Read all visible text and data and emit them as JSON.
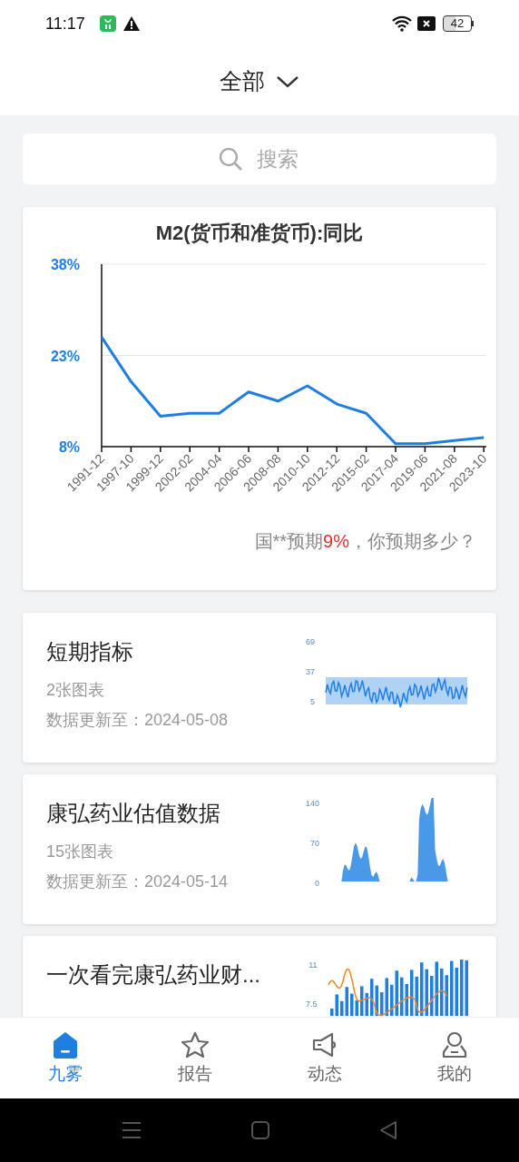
{
  "status_bar": {
    "time": "11:17",
    "battery": "42"
  },
  "header": {
    "title": "全部"
  },
  "search": {
    "placeholder": "搜索"
  },
  "main_chart": {
    "title": "M2(货币和准货币):同比",
    "footer": {
      "prefix": "国**预期",
      "highlight": "9%",
      "suffix": "，你预期多少？"
    },
    "chart_data": {
      "type": "line",
      "categories": [
        "1991-12",
        "1997-10",
        "1999-12",
        "2002-02",
        "2004-04",
        "2006-06",
        "2008-08",
        "2010-10",
        "2012-12",
        "2015-02",
        "2017-04",
        "2019-06",
        "2021-08",
        "2023-10"
      ],
      "series": [
        {
          "color": "#1e7fe0",
          "values": [
            26,
            18.7,
            13,
            13.5,
            13.5,
            17,
            15.5,
            18,
            15,
            13.5,
            8.5,
            8.5,
            9,
            9.5
          ]
        }
      ],
      "ylim": [
        8,
        38
      ],
      "yticks": [
        {
          "value": 38,
          "label": "38%"
        },
        {
          "value": 23,
          "label": "23%"
        },
        {
          "value": 8,
          "label": "8%"
        }
      ]
    }
  },
  "cards": [
    {
      "title": "短期指标",
      "count": "2张图表",
      "updated": "数据更新至：2024-05-08",
      "thumbnail": {
        "kind": "line",
        "y_ticks": [
          "69",
          "37",
          "5"
        ]
      }
    },
    {
      "title": "康弘药业估值数据",
      "count": "15张图表",
      "updated": "数据更新至：2024-05-14",
      "thumbnail": {
        "kind": "area",
        "y_ticks": [
          "140",
          "70",
          "0"
        ]
      }
    },
    {
      "title": "一次看完康弘药业财...",
      "thumbnail": {
        "kind": "combo",
        "y_ticks": [
          "11",
          "7.5"
        ]
      }
    }
  ],
  "tabs": [
    {
      "label": "九雾",
      "selected": true
    },
    {
      "label": "报告",
      "selected": false
    },
    {
      "label": "动态",
      "selected": false
    },
    {
      "label": "我的",
      "selected": false
    }
  ]
}
